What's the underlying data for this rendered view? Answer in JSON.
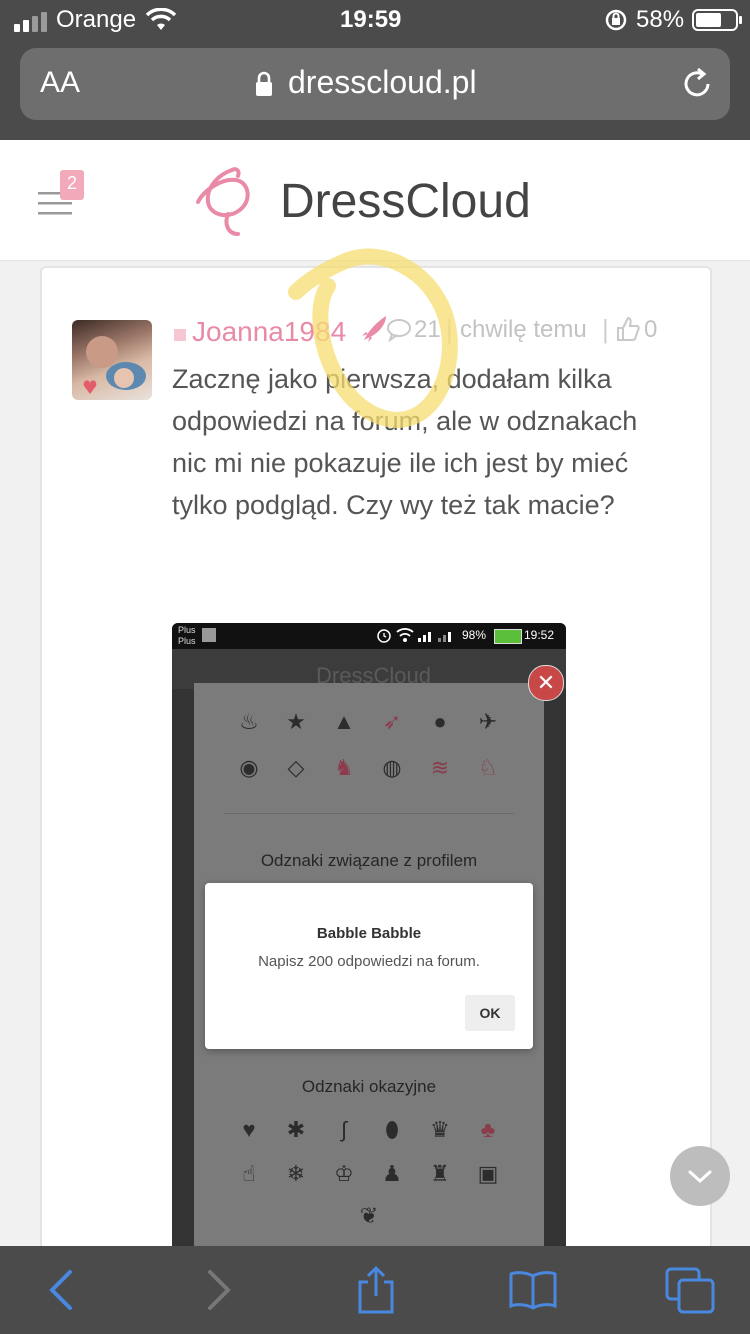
{
  "status_bar": {
    "carrier": "Orange",
    "time": "19:59",
    "battery": "58%"
  },
  "browser": {
    "text_size_label": "AA",
    "url": "dresscloud.pl"
  },
  "site": {
    "brand": "DressCloud",
    "notification_count": "2"
  },
  "post": {
    "username": "Joanna1984",
    "reply_count": "21",
    "separator": "|",
    "time_label": "chwilę temu",
    "likes": "0",
    "body_lines": [
      "Zacznę jako pierwsza, dodałam kilka",
      "odpowiedzi na forum, ale w odznakach",
      "nic mi nie pokazuje ile ich jest by mieć",
      "tylko podgląd. Czy wy też tak macie?"
    ]
  },
  "attachment": {
    "carrier_line1": "Plus",
    "carrier_line2": "Plus",
    "battery": "98%",
    "time": "19:52",
    "brand_faded": "DressCloud",
    "section_profile": "Odznaki związane z profilem",
    "section_occasional": "Odznaki okazyjne",
    "dialog": {
      "title": "Babble Babble",
      "message": "Napisz 200 odpowiedzi na forum.",
      "ok_label": "OK"
    }
  },
  "colors": {
    "accent_pink": "#e98aa6",
    "chrome_dark": "#4b4b4b",
    "ios_blue": "#4a88e0",
    "highlight_yellow": "#f6dd72"
  }
}
